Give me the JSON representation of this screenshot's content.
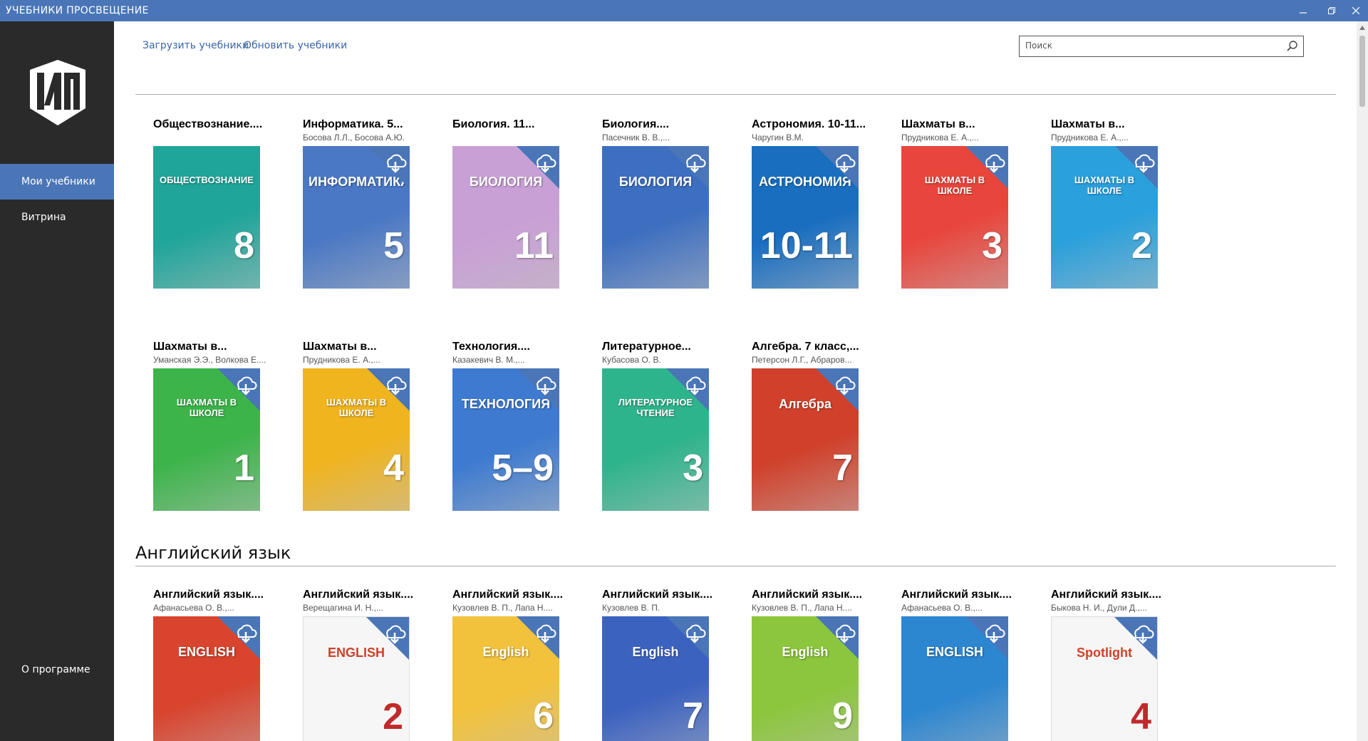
{
  "window": {
    "title": "УЧЕБНИКИ ПРОСВЕЩЕНИЕ",
    "min_icon": "minimize-icon",
    "max_icon": "restore-icon",
    "close_icon": "close-icon"
  },
  "sidebar": {
    "logo_icon": "prosveshchenie-logo-icon",
    "items": [
      {
        "label": "Мои учебники",
        "active": true
      },
      {
        "label": "Витрина",
        "active": false
      }
    ],
    "about": "О программе"
  },
  "toolbar": {
    "load_label": "Загрузить учебники",
    "update_label": "Обновить учебники",
    "search_placeholder": "Поиск"
  },
  "colors": {
    "accent": "#4a76b8",
    "sidebar_bg": "#2a2a2a",
    "link": "#3b65a8"
  },
  "sections": [
    {
      "title": "",
      "books": [
        {
          "title": "Обществознание....",
          "author": "",
          "cover_text": "ОБЩЕСТВОЗНАНИЕ",
          "cover_num": "8",
          "color": "#1fa59a",
          "download": false
        },
        {
          "title": "Информатика. 5...",
          "author": "Босова Л.Л., Босова А.Ю.",
          "cover_text": "ИНФОРМАТИКА",
          "cover_num": "5",
          "color": "#4a78c4",
          "download": true
        },
        {
          "title": "Биология. 11...",
          "author": "",
          "cover_text": "БИОЛОГИЯ",
          "cover_num": "11",
          "color": "#c9a0d6",
          "download": true
        },
        {
          "title": "Биология....",
          "author": "Пасечник В. В.,...",
          "cover_text": "БИОЛОГИЯ",
          "cover_num": "",
          "color": "#3d6fc0",
          "download": true
        },
        {
          "title": "Астрономия. 10-11...",
          "author": "Чаругин В.М.",
          "cover_text": "АСТРОНОМИЯ",
          "cover_num": "10-11",
          "color": "#1a6ec0",
          "download": true
        },
        {
          "title": "Шахматы в...",
          "author": "Прудникова Е. А.,...",
          "cover_text": "ШАХМАТЫ В ШКОЛЕ",
          "cover_num": "3",
          "color": "#e8463c",
          "download": true
        },
        {
          "title": "Шахматы в...",
          "author": "Прудникова Е. А.,...",
          "cover_text": "ШАХМАТЫ В ШКОЛЕ",
          "cover_num": "2",
          "color": "#2aa0dc",
          "download": true
        },
        {
          "title": "Шахматы в...",
          "author": "Уманская Э.Э., Волкова Е....",
          "cover_text": "ШАХМАТЫ В ШКОЛЕ",
          "cover_num": "1",
          "color": "#3cb44a",
          "download": true
        },
        {
          "title": "Шахматы в...",
          "author": "Прудникова Е. А.,...",
          "cover_text": "ШАХМАТЫ В ШКОЛЕ",
          "cover_num": "4",
          "color": "#f0b41e",
          "download": true
        },
        {
          "title": "Технология....",
          "author": "Казакевич В. М.,...",
          "cover_text": "ТЕХНОЛОГИЯ",
          "cover_num": "5–9",
          "color": "#3d7ad0",
          "download": true
        },
        {
          "title": "Литературное...",
          "author": "Кубасова О. В.",
          "cover_text": "ЛИТЕРАТУРНОЕ ЧТЕНИЕ",
          "cover_num": "3",
          "color": "#2eb48c",
          "download": true
        },
        {
          "title": "Алгебра. 7 класс,...",
          "author": "Петерсон Л.Г., Абраров...",
          "cover_text": "Алгебра",
          "cover_num": "7",
          "color": "#d0402a",
          "download": true
        }
      ]
    },
    {
      "title": "Английский язык",
      "books": [
        {
          "title": "Английский язык....",
          "author": "Афанасьева О. В.,...",
          "cover_text": "ENGLISH",
          "cover_num": "",
          "color": "#d8442e",
          "download": true
        },
        {
          "title": "Английский язык....",
          "author": "Верещагина И. Н.,...",
          "cover_text": "ENGLISH",
          "cover_num": "2",
          "color": "#ffffff",
          "download": true
        },
        {
          "title": "Английский язык....",
          "author": "Кузовлев В. П., Лапа Н....",
          "cover_text": "English",
          "cover_num": "6",
          "color": "#f2c23c",
          "download": true
        },
        {
          "title": "Английский язык....",
          "author": "Кузовлев В. П.",
          "cover_text": "English",
          "cover_num": "7",
          "color": "#3c62c0",
          "download": true
        },
        {
          "title": "Английский язык....",
          "author": "Кузовлев В. П., Лапа Н....",
          "cover_text": "English",
          "cover_num": "9",
          "color": "#8cc63c",
          "download": true
        },
        {
          "title": "Английский язык....",
          "author": "Афанасьева О. В.,...",
          "cover_text": "ENGLISH",
          "cover_num": "",
          "color": "#2c86d0",
          "download": true
        },
        {
          "title": "Английский язык....",
          "author": "Быкова Н. И., Дули Д.,...",
          "cover_text": "Spotlight",
          "cover_num": "4",
          "color": "#ffffff",
          "download": true
        }
      ]
    }
  ]
}
